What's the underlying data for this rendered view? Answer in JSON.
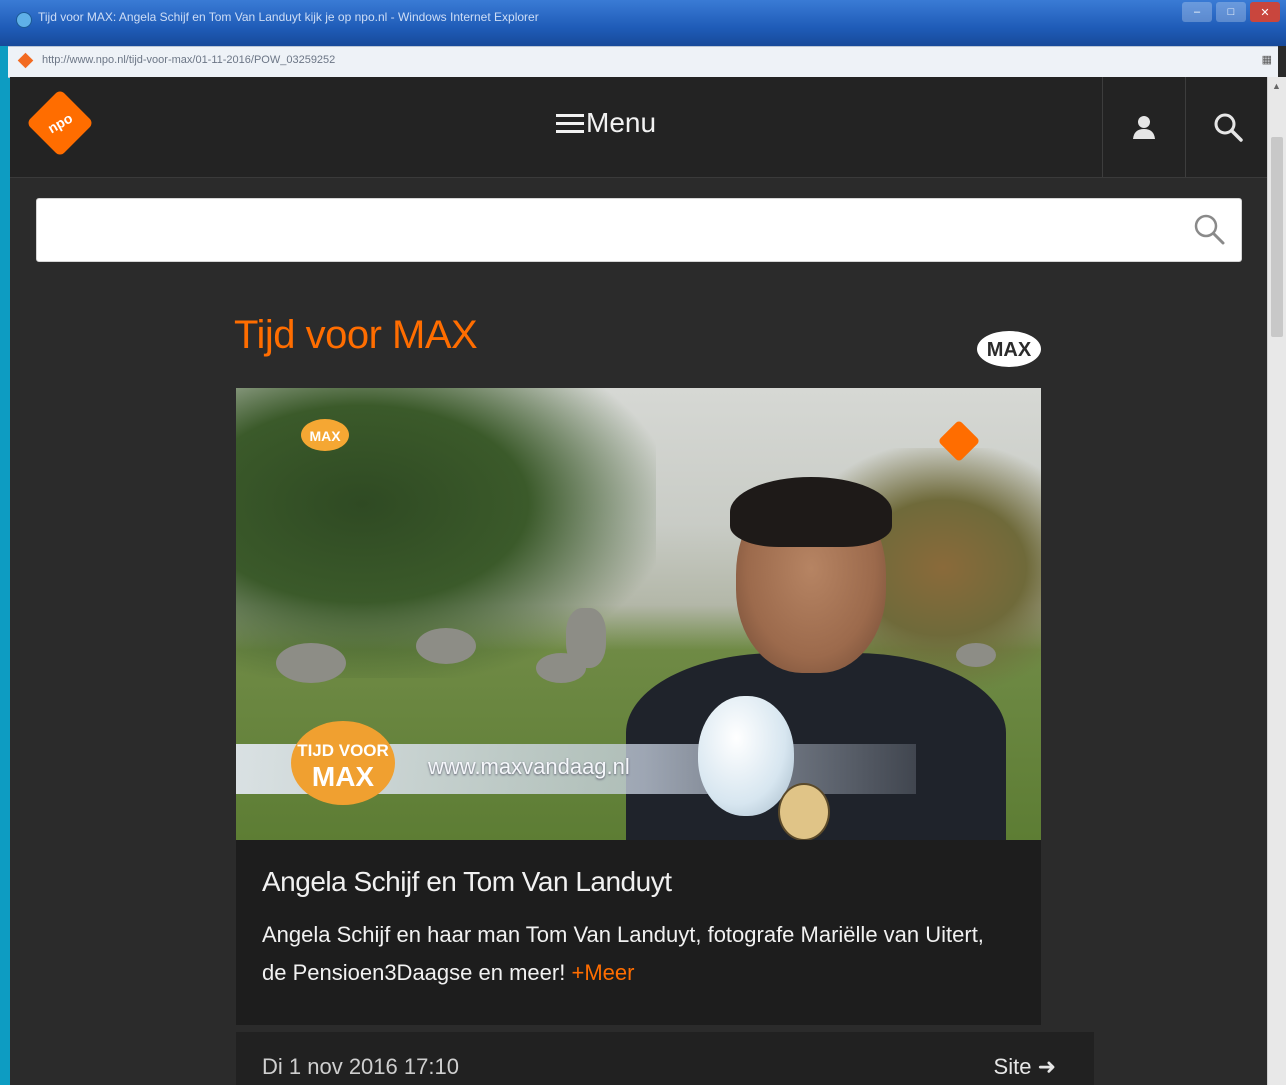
{
  "window": {
    "title": "Tijd voor MAX: Angela Schijf en Tom Van Landuyt kijk je op npo.nl - Windows Internet Explorer"
  },
  "addressbar": {
    "url": "http://www.npo.nl/tijd-voor-max/01-11-2016/POW_03259252"
  },
  "header": {
    "menu_label": "Menu",
    "logo_text": "npo"
  },
  "search": {
    "value": ""
  },
  "program": {
    "title": "Tijd voor MAX",
    "broadcaster_logo": "MAX"
  },
  "video": {
    "lower_third_url": "www.maxvandaag.nl",
    "badge_top": "TIJD VOOR",
    "badge_bottom": "MAX"
  },
  "episode": {
    "title": "Angela Schijf en Tom Van Landuyt",
    "description": "Angela Schijf en haar man Tom Van Landuyt, fotografe Mariëlle van Uitert, de Pensioen3Daagse en meer!",
    "more_label": "Meer",
    "date": "Di 1 nov 2016 17:10",
    "site_label": "Site"
  },
  "colors": {
    "accent": "#ff6d00",
    "background": "#2b2b2b"
  }
}
